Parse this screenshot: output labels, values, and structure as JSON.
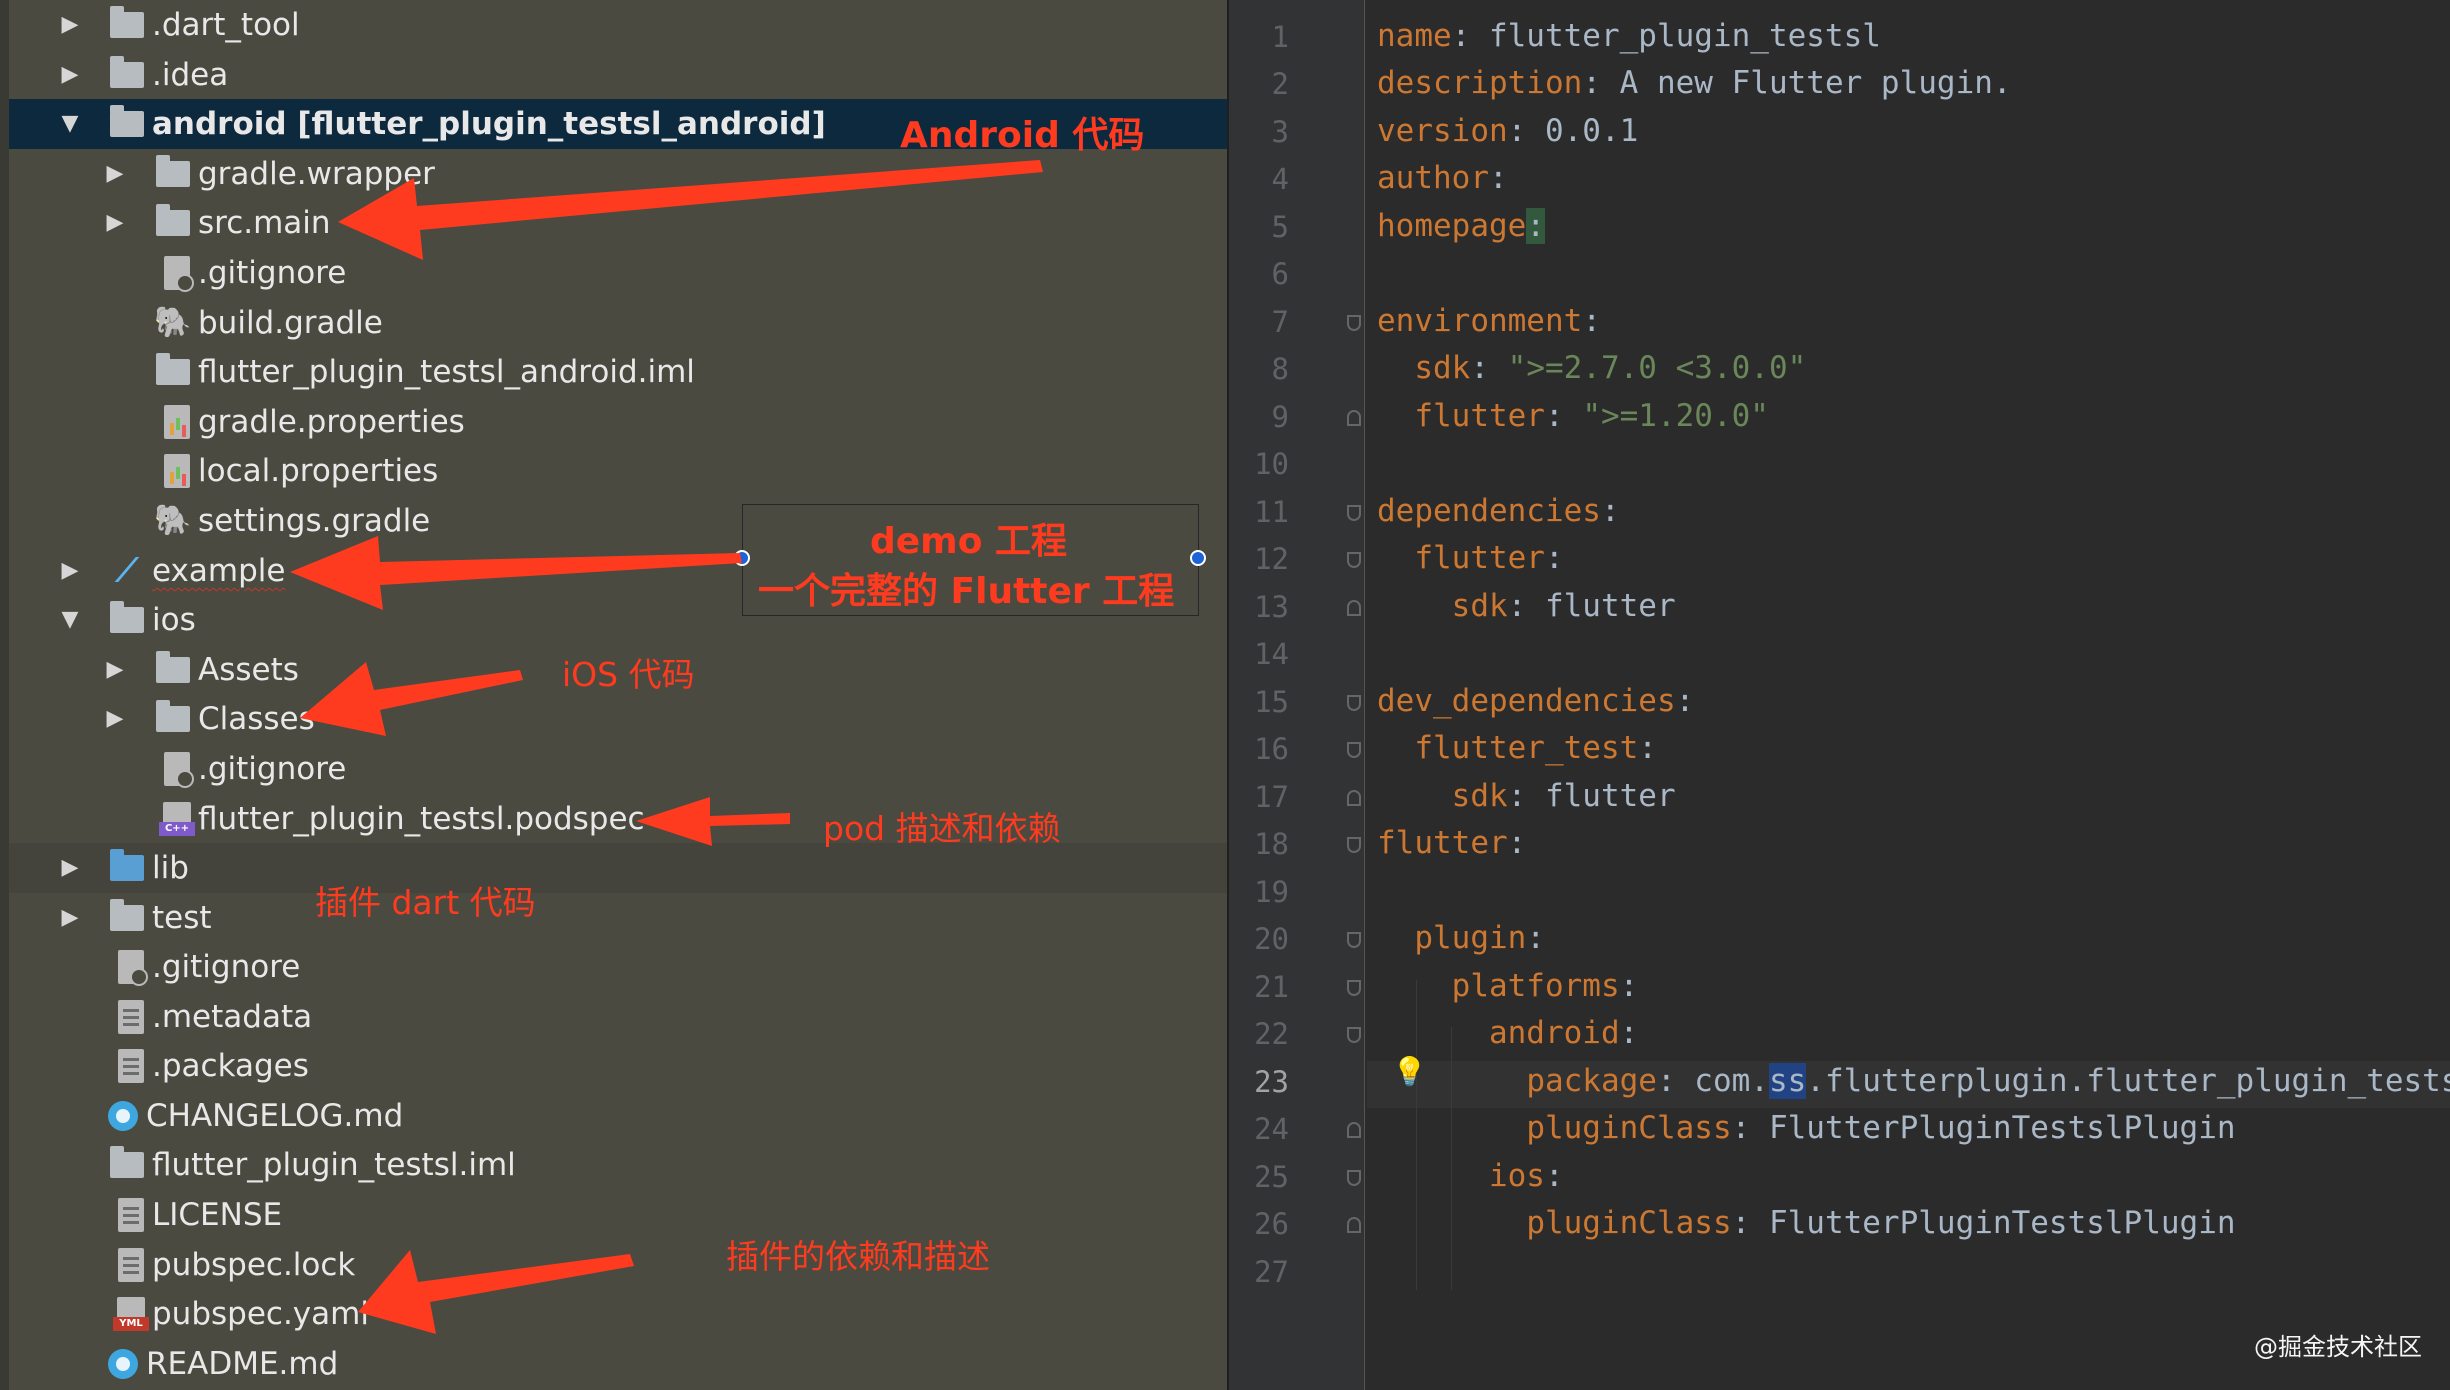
{
  "tree": {
    "rows": [
      {
        "label": ".dart_tool",
        "icon": "folder-icon",
        "expanded": false
      },
      {
        "label": ".idea",
        "icon": "folder-icon",
        "expanded": false
      },
      {
        "label": "android [flutter_plugin_testsl_android]",
        "icon": "folder-icon",
        "expanded": true,
        "selected": true
      },
      {
        "label": "gradle.wrapper",
        "icon": "folder-icon",
        "expanded": false
      },
      {
        "label": "src.main",
        "icon": "folder-icon",
        "expanded": false
      },
      {
        "label": ".gitignore",
        "icon": "git-file-icon"
      },
      {
        "label": "build.gradle",
        "icon": "gradle-icon"
      },
      {
        "label": "flutter_plugin_testsl_android.iml",
        "icon": "module-file-icon"
      },
      {
        "label": "gradle.properties",
        "icon": "properties-file-icon"
      },
      {
        "label": "local.properties",
        "icon": "properties-file-icon"
      },
      {
        "label": "settings.gradle",
        "icon": "gradle-icon"
      },
      {
        "label": "example",
        "icon": "flutter-icon",
        "expanded": false
      },
      {
        "label": "ios",
        "icon": "folder-icon",
        "expanded": true
      },
      {
        "label": "Assets",
        "icon": "folder-icon",
        "expanded": false
      },
      {
        "label": "Classes",
        "icon": "folder-icon",
        "expanded": false
      },
      {
        "label": ".gitignore",
        "icon": "git-file-icon"
      },
      {
        "label": "flutter_plugin_testsl.podspec",
        "icon": "podspec-file-icon"
      },
      {
        "label": "lib",
        "icon": "source-folder-icon",
        "expanded": false
      },
      {
        "label": "test",
        "icon": "folder-icon",
        "expanded": false
      },
      {
        "label": ".gitignore",
        "icon": "git-file-icon"
      },
      {
        "label": ".metadata",
        "icon": "text-file-icon"
      },
      {
        "label": ".packages",
        "icon": "text-file-icon"
      },
      {
        "label": "CHANGELOG.md",
        "icon": "markdown-icon"
      },
      {
        "label": "flutter_plugin_testsl.iml",
        "icon": "module-file-icon"
      },
      {
        "label": "LICENSE",
        "icon": "text-file-icon"
      },
      {
        "label": "pubspec.lock",
        "icon": "text-file-icon"
      },
      {
        "label": "pubspec.yaml",
        "icon": "yaml-file-icon"
      },
      {
        "label": "README.md",
        "icon": "markdown-icon"
      }
    ]
  },
  "annotations": {
    "android": "Android 代码",
    "demo_line1": "demo 工程",
    "demo_line2": "一个完整的 Flutter 工程",
    "ios": "iOS 代码",
    "pod": "pod 描述和依赖",
    "dart": "插件 dart 代码",
    "pubspec": "插件的依赖和描述",
    "color": "#ff3b1f"
  },
  "editor": {
    "current_line": 23,
    "line_numbers": [
      "1",
      "2",
      "3",
      "4",
      "5",
      "6",
      "7",
      "8",
      "9",
      "10",
      "11",
      "12",
      "13",
      "14",
      "15",
      "16",
      "17",
      "18",
      "19",
      "20",
      "21",
      "22",
      "23",
      "24",
      "25",
      "26",
      "27"
    ],
    "lines": [
      {
        "key": "name",
        "sep": ": ",
        "val": "flutter_plugin_testsl"
      },
      {
        "key": "description",
        "sep": ": ",
        "val": "A new Flutter plugin."
      },
      {
        "key": "version",
        "sep": ": ",
        "val": "0.0.1"
      },
      {
        "key": "author",
        "sep": ":",
        "val": ""
      },
      {
        "key": "homepage",
        "sep": ":",
        "val": ""
      },
      {
        "key": "",
        "sep": "",
        "val": ""
      },
      {
        "key": "environment",
        "sep": ":",
        "val": ""
      },
      {
        "key": "sdk",
        "sep": ": ",
        "val": "\">=2.7.0 <3.0.0\""
      },
      {
        "key": "flutter",
        "sep": ": ",
        "val": "\">=1.20.0\""
      },
      {
        "key": "",
        "sep": "",
        "val": ""
      },
      {
        "key": "dependencies",
        "sep": ":",
        "val": ""
      },
      {
        "key": "flutter",
        "sep": ":",
        "val": ""
      },
      {
        "key": "sdk",
        "sep": ": ",
        "val": "flutter"
      },
      {
        "key": "",
        "sep": "",
        "val": ""
      },
      {
        "key": "dev_dependencies",
        "sep": ":",
        "val": ""
      },
      {
        "key": "flutter_test",
        "sep": ":",
        "val": ""
      },
      {
        "key": "sdk",
        "sep": ": ",
        "val": "flutter"
      },
      {
        "key": "flutter",
        "sep": ":",
        "val": ""
      },
      {
        "key": "",
        "sep": "",
        "val": ""
      },
      {
        "key": "plugin",
        "sep": ":",
        "val": ""
      },
      {
        "key": "platforms",
        "sep": ":",
        "val": ""
      },
      {
        "key": "android",
        "sep": ":",
        "val": ""
      },
      {
        "key": "package",
        "sep": ": ",
        "val_pre": "com.",
        "val_hl": "ss",
        "val_post": ".flutterplugin.flutter_plugin_testsl"
      },
      {
        "key": "pluginClass",
        "sep": ": ",
        "val": "FlutterPluginTestslPlugin"
      },
      {
        "key": "ios",
        "sep": ":",
        "val": ""
      },
      {
        "key": "pluginClass",
        "sep": ": ",
        "val": "FlutterPluginTestslPlugin"
      },
      {
        "key": "",
        "sep": "",
        "val": ""
      }
    ]
  },
  "watermark": "@掘金技术社区"
}
